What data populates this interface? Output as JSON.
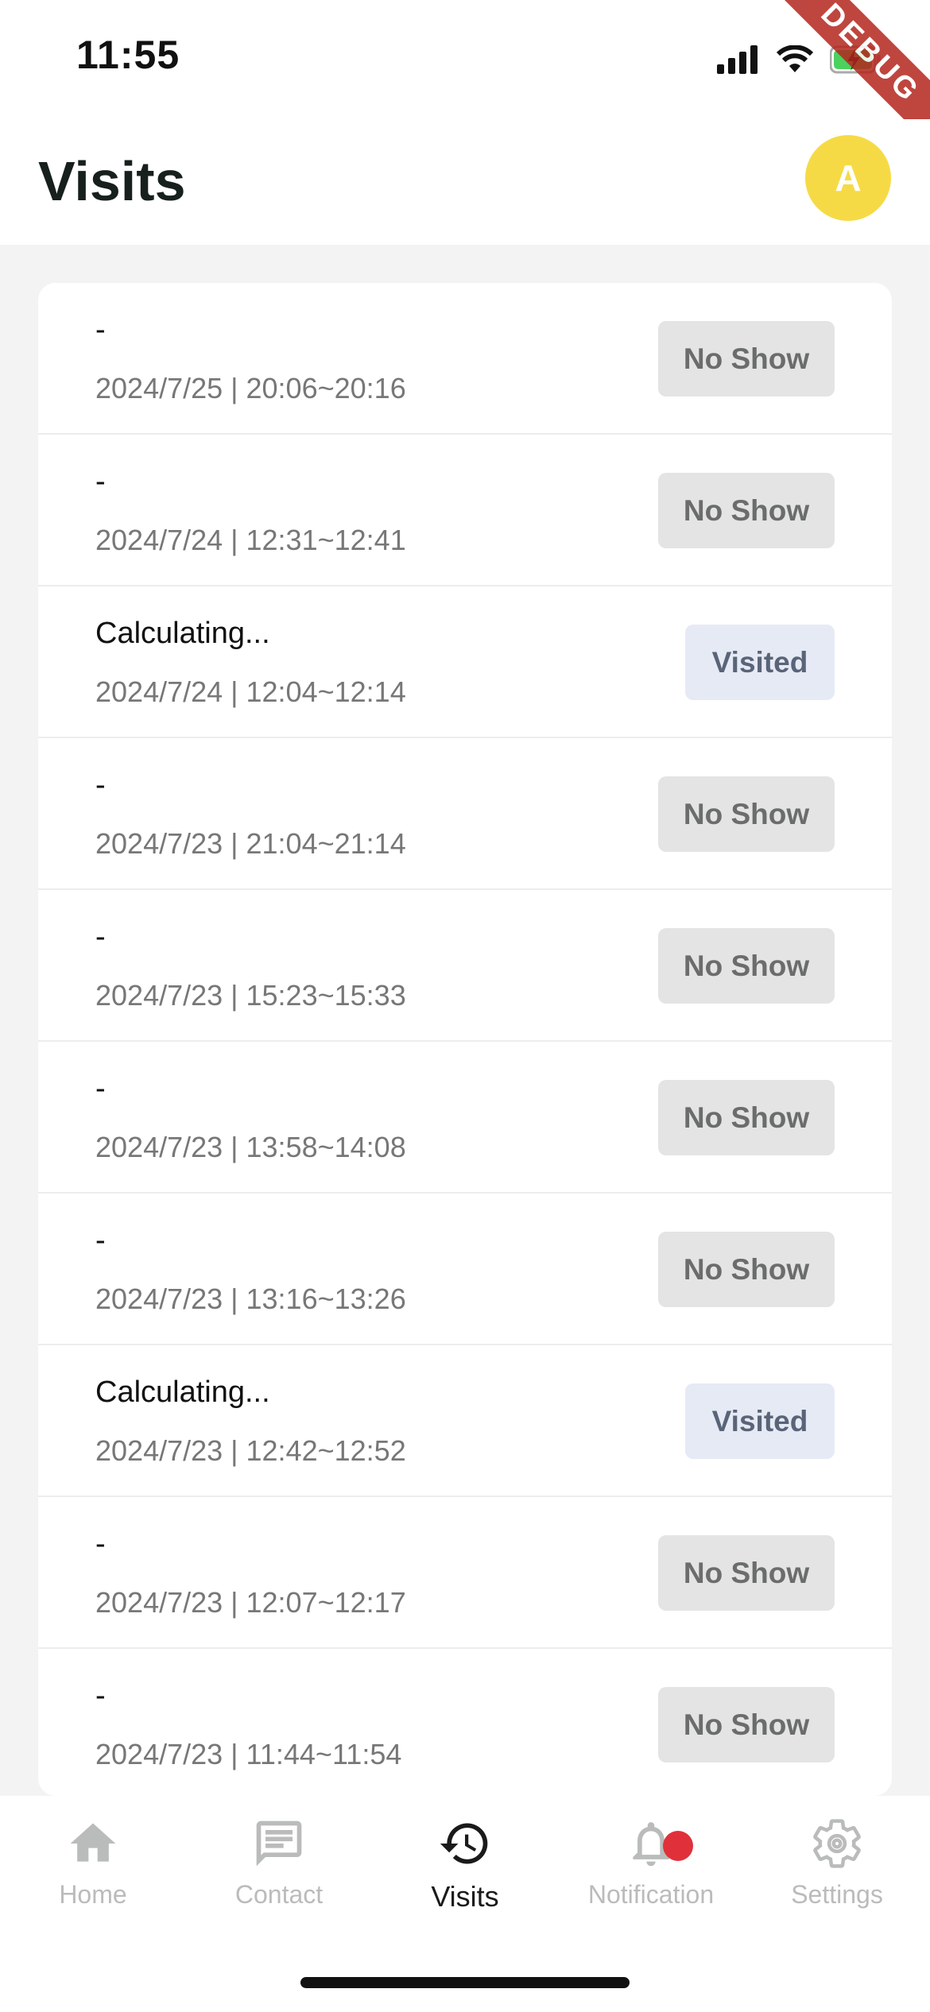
{
  "status_bar": {
    "time": "11:55",
    "debug_label": "DEBUG"
  },
  "header": {
    "title": "Visits",
    "avatar_initial": "A"
  },
  "visits": [
    {
      "title": "-",
      "datetime": "2024/7/25 | 20:06~20:16",
      "status": "No Show"
    },
    {
      "title": "-",
      "datetime": "2024/7/24 | 12:31~12:41",
      "status": "No Show"
    },
    {
      "title": "Calculating...",
      "datetime": "2024/7/24 | 12:04~12:14",
      "status": "Visited"
    },
    {
      "title": "-",
      "datetime": "2024/7/23 | 21:04~21:14",
      "status": "No Show"
    },
    {
      "title": "-",
      "datetime": "2024/7/23 | 15:23~15:33",
      "status": "No Show"
    },
    {
      "title": "-",
      "datetime": "2024/7/23 | 13:58~14:08",
      "status": "No Show"
    },
    {
      "title": "-",
      "datetime": "2024/7/23 | 13:16~13:26",
      "status": "No Show"
    },
    {
      "title": "Calculating...",
      "datetime": "2024/7/23 | 12:42~12:52",
      "status": "Visited"
    },
    {
      "title": "-",
      "datetime": "2024/7/23 | 12:07~12:17",
      "status": "No Show"
    },
    {
      "title": "-",
      "datetime": "2024/7/23 | 11:44~11:54",
      "status": "No Show"
    }
  ],
  "nav": {
    "home": "Home",
    "contact": "Contact",
    "visits": "Visits",
    "notification": "Notification",
    "settings": "Settings"
  },
  "colors": {
    "accent_avatar": "#f6da45",
    "no_show_pill": "#e3e4e3",
    "visited_pill": "#e6eaf5",
    "notification_badge": "#e0313a"
  },
  "icons": {
    "home": "home-icon",
    "contact": "message-icon",
    "visits": "history-icon",
    "notification": "bell-icon",
    "settings": "gear-icon"
  }
}
